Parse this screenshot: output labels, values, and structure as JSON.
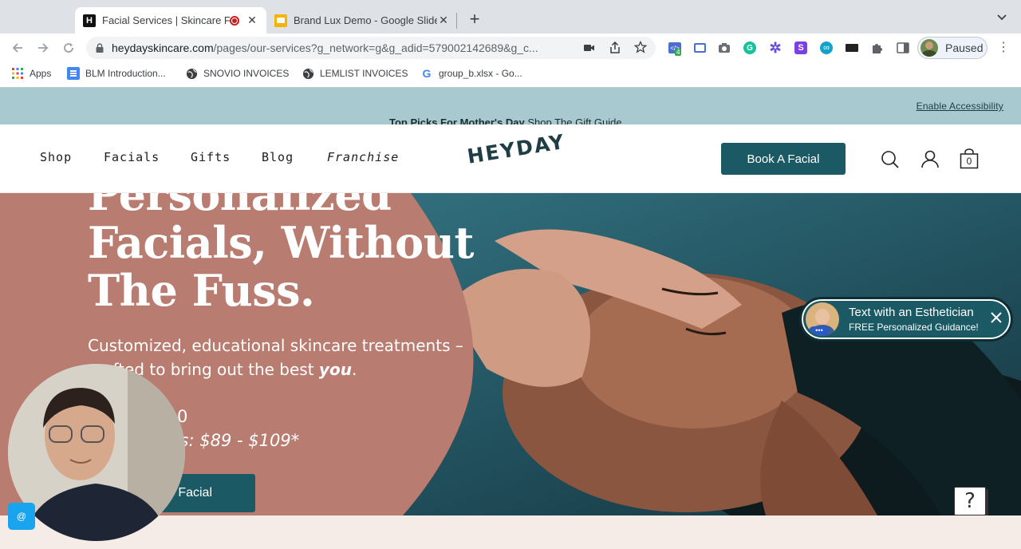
{
  "browser": {
    "tabs": [
      {
        "title": "Facial Services | Skincare F",
        "active": true
      },
      {
        "title": "Brand Lux Demo - Google Slide",
        "active": false
      }
    ],
    "new_tab_symbol": "+",
    "url_host": "heydayskincare.com",
    "url_path": "/pages/our-services?g_network=g&g_adid=579002142689&g_c...",
    "profile_label": "Paused",
    "extension_badge": "4",
    "bookmarks": [
      {
        "label": "Apps",
        "icon": "apps-grid-icon"
      },
      {
        "label": "BLM Introduction...",
        "icon": "docs-icon"
      },
      {
        "label": "SNOVIO INVOICES",
        "icon": "globe-icon"
      },
      {
        "label": "LEMLIST INVOICES",
        "icon": "globe-icon"
      },
      {
        "label": "group_b.xlsx - Go...",
        "icon": "google-icon"
      }
    ]
  },
  "promo": {
    "accessibility_link": "Enable Accessibility",
    "bold_text": "Top Picks For Mother's Day",
    "link_text": "Shop The Gift Guide"
  },
  "nav": {
    "links": [
      "Shop",
      "Facials",
      "Gifts",
      "Blog",
      "Franchise"
    ],
    "logo": "HEYDAY",
    "cta": "Book A Facial",
    "cart_count": "0"
  },
  "hero": {
    "heading_line1": "Personalized",
    "heading_line2": "Facials, Without",
    "heading_line3": "The Fuss.",
    "sub_line1": "Customized, educational skincare treatments –",
    "sub_line2_start": "crafted to bring out the best ",
    "sub_line2_em": "you",
    "sub_line2_end": ".",
    "price_partial": "0",
    "members_price_partial": "ers: $89 - $109*",
    "cta_partial": "Facial"
  },
  "chat_widget": {
    "title": "Text with an Esthetician",
    "subtitle": "FREE Personalized Guidance!"
  },
  "help_button": "?",
  "colors": {
    "teal": "#1b5a64",
    "terracotta": "#b97c70",
    "promo_bg": "#a8c9d0"
  }
}
